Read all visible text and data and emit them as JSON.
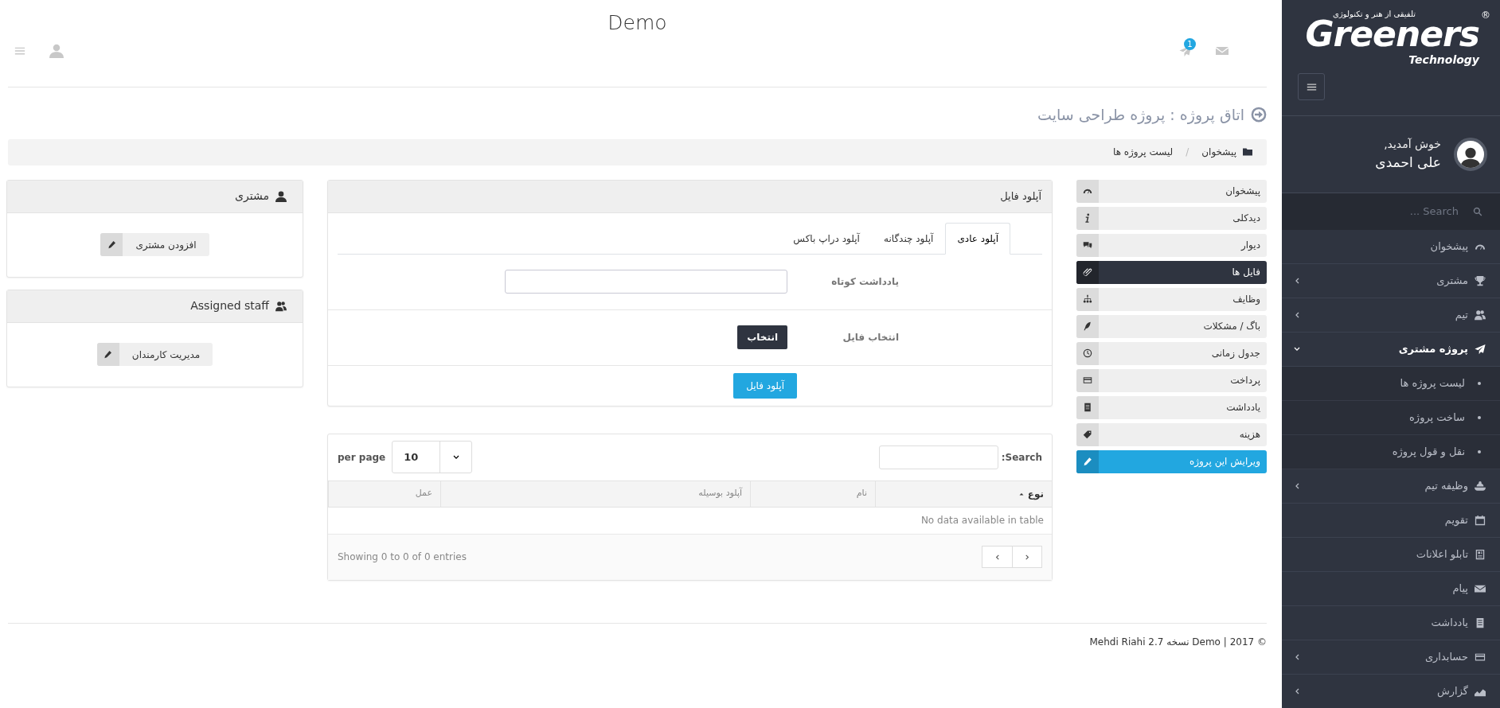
{
  "sidebar": {
    "logo": {
      "name": "Greeners",
      "tagline": "Technology",
      "slogan": "تلفیقی از هنر و تکنولوژی",
      "mark": "®"
    },
    "user": {
      "greeting": "خوش آمدید,",
      "name": "علی احمدی"
    },
    "search": {
      "placeholder": "Search ..."
    },
    "items": [
      {
        "label": "پیشخوان",
        "submenu": false,
        "expanded": false
      },
      {
        "label": "مشتری",
        "submenu": true,
        "expanded": false
      },
      {
        "label": "تیم",
        "submenu": true,
        "expanded": false
      },
      {
        "label": "پروژه مشتری",
        "submenu": true,
        "expanded": true,
        "children": [
          {
            "label": "لیست پروژه ها"
          },
          {
            "label": "ساخت پروژه"
          },
          {
            "label": "نقل و قول پروژه"
          }
        ]
      },
      {
        "label": "وظیفه تیم",
        "submenu": true,
        "expanded": false
      },
      {
        "label": "تقویم",
        "submenu": false,
        "expanded": false
      },
      {
        "label": "تابلو اعلانات",
        "submenu": false,
        "expanded": false
      },
      {
        "label": "پیام",
        "submenu": false,
        "expanded": false
      },
      {
        "label": "یادداشت",
        "submenu": false,
        "expanded": false
      },
      {
        "label": "حسابداری",
        "submenu": true,
        "expanded": false
      },
      {
        "label": "گزارش",
        "submenu": true,
        "expanded": false
      }
    ]
  },
  "header": {
    "title": "Demo",
    "notification_count": "1"
  },
  "page_title": "اتاق پروژه : پروژه طراحی سایت",
  "breadcrumb": {
    "items": [
      "پیشخوان",
      "لیست پروژه ها"
    ],
    "separator": "/"
  },
  "project_nav": [
    {
      "label": "پیشخوان",
      "kind": "link",
      "selected": false
    },
    {
      "label": "دیدکلی",
      "kind": "link",
      "selected": false
    },
    {
      "label": "دیوار",
      "kind": "link",
      "selected": false
    },
    {
      "label": "فایل ها",
      "kind": "link",
      "selected": true
    },
    {
      "label": "وظایف",
      "kind": "link",
      "selected": false
    },
    {
      "label": "باگ / مشکلات",
      "kind": "link",
      "selected": false
    },
    {
      "label": "جدول زمانی",
      "kind": "link",
      "selected": false
    },
    {
      "label": "پرداخت",
      "kind": "link",
      "selected": false
    },
    {
      "label": "یادداشت",
      "kind": "link",
      "selected": false
    },
    {
      "label": "هزینه",
      "kind": "link",
      "selected": false
    },
    {
      "label": "ویرایش این پروژه",
      "kind": "action",
      "selected": false
    }
  ],
  "upload": {
    "title": "آپلود فایل",
    "tabs": [
      {
        "label": "آپلود عادی",
        "selected": true
      },
      {
        "label": "آپلود چندگانه",
        "selected": false
      },
      {
        "label": "آپلود دراپ باکس",
        "selected": false
      }
    ],
    "fields": [
      {
        "label": "یادداشت کوتاه",
        "kind": "text"
      },
      {
        "label": "انتخاب فایل",
        "kind": "file",
        "button": "انتخاب"
      }
    ],
    "submit": "آپلود فایل"
  },
  "files_table": {
    "search_label": "Search:",
    "page_size": "10",
    "page_size_label": "per page",
    "columns": [
      {
        "label": "نوع",
        "sorted": true
      },
      {
        "label": "نام",
        "sorted": false
      },
      {
        "label": "آپلود بوسیله",
        "sorted": false
      },
      {
        "label": "عمل",
        "sorted": false
      }
    ],
    "empty": "No data available in table",
    "info": "Showing 0 to 0 of 0 entries"
  },
  "client_card": {
    "title": "مشتری",
    "button": "افزودن مشتری"
  },
  "staff_card": {
    "title": "Assigned staff",
    "button": "مدیریت کارمندان"
  },
  "footer": "© 2017 | Demo نسخه 2.7 Mehdi Riahi"
}
